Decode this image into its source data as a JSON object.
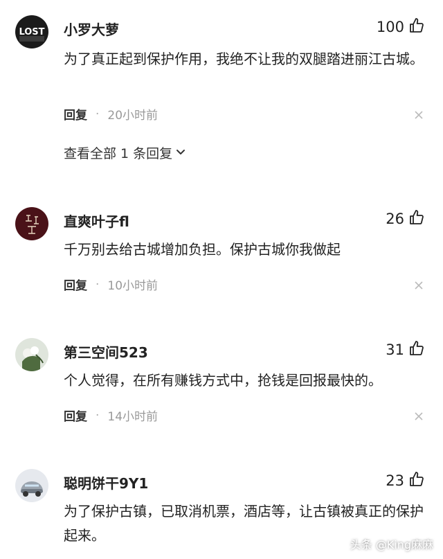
{
  "comments": [
    {
      "username": "小罗大萝",
      "likes": "100",
      "content": "为了真正起到保护作用，我绝不让我的双腿踏进丽江古城。",
      "reply_label": "回复",
      "time": "20小时前",
      "view_replies": "查看全部 1 条回复",
      "avatar_text": "LOST"
    },
    {
      "username": "直爽叶子fl",
      "likes": "26",
      "content": "千万别去给古城增加负担。保护古城你我做起",
      "reply_label": "回复",
      "time": "10小时前"
    },
    {
      "username": "第三空间523",
      "likes": "31",
      "content": "个人觉得，在所有赚钱方式中，抢钱是回报最快的。",
      "reply_label": "回复",
      "time": "14小时前"
    },
    {
      "username": "聪明饼干9Y1",
      "likes": "23",
      "content": "为了保护古镇，已取消机票，酒店等，让古镇被真正的保护起来。"
    }
  ],
  "watermark": "头条 @King麻麻",
  "icons": {
    "like": "thumbs-up-icon",
    "dismiss": "close-icon",
    "expand": "chevron-down-icon"
  }
}
